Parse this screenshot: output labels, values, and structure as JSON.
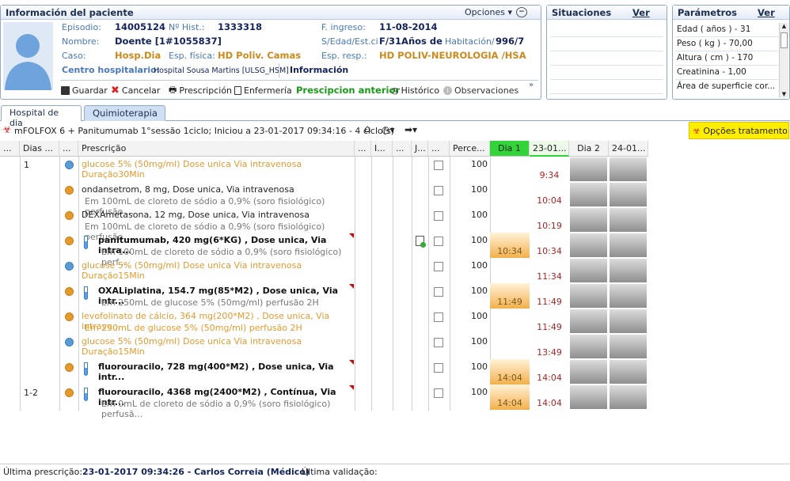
{
  "patient_panel": {
    "title": "Información del paciente",
    "options_label": "Opciones",
    "fields": {
      "episodio_label": "Episodio:",
      "episodio": "14005124",
      "nhist_label": "Nº Hist.:",
      "nhist": "1333318",
      "fingreso_label": "F. ingreso:",
      "fingreso": "11-08-2014",
      "nombre_label": "Nombre:",
      "nombre": "Doente [1#1055837]",
      "sedad_label": "S/Edad/Est.ci",
      "sedad": "F/31Años de",
      "habitacion_label": "Habitación/",
      "habitacion": "996/7",
      "caso_label": "Caso:",
      "caso": "Hosp.Dia",
      "espfisica_label": "Esp. física:",
      "espfisica": "HD Poliv. Camas",
      "espresp_label": "Esp. resp.:",
      "espresp": "HD POLIV-NEUROLOGIA /HSA",
      "centro_label": "Centro hospitalario:",
      "centro": "Hospital Sousa Martins [ULSG_HSM]",
      "info_label": "Información"
    },
    "toolbar": {
      "guardar": "Guardar",
      "cancelar": "Cancelar",
      "prescripcion": "Prescripción",
      "enfermeria": "Enfermería",
      "prescripcion_anterior": "Prescipcion anterior",
      "historico": "Histórico",
      "observaciones": "Observaciones"
    }
  },
  "situaciones": {
    "title": "Situaciones",
    "ver": "Ver"
  },
  "parametros": {
    "title": "Parámetros",
    "ver": "Ver",
    "items": [
      "Edad ( años ) - 31",
      "Peso ( kg ) - 70,00",
      "Altura ( cm ) - 170",
      "Creatinina - 1,00",
      "Área de superficie cor..."
    ]
  },
  "tabs": [
    "Hospital de dia",
    "Quimioterapia"
  ],
  "protocol": {
    "text": "mFOLFOX 6 + Panitumumab 1°sessão 1ciclo; Iniciou a 23-01-2017 09:34:16 - 4 ciclo(s)",
    "options_button": "Opções tratamento"
  },
  "columns": [
    "...",
    "Dias ...",
    "...",
    "Prescrição",
    "...",
    "I...",
    "...",
    "J...",
    "...",
    "Perce...",
    "Dia 1",
    "23-01...",
    "Dia 2",
    "24-01..."
  ],
  "rows": [
    {
      "dias": "1",
      "dot": "blue",
      "l1": "glucose 5% (50mg/ml) Dose unica Via intravenosa Duração30Min",
      "l2": "",
      "pct": "100",
      "d1": "",
      "t": "9:34",
      "style": "orange",
      "tube": false
    },
    {
      "dias": "",
      "dot": "orange",
      "l1": "ondansetrom, 8 mg,   Dose unica, Via intravenosa",
      "l2": "Em 100mL de cloreto de sódio a 0,9% (soro fisiológico) perfusão ...",
      "pct": "100",
      "d1": "",
      "t": "10:04",
      "style": "normal",
      "tube": false
    },
    {
      "dias": "",
      "dot": "orange",
      "l1": "DEXAmetasona, 12 mg,   Dose unica, Via intravenosa",
      "l2": "Em 100mL de cloreto de sódio a 0,9% (soro fisiológico) perfusão ...",
      "pct": "100",
      "d1": "",
      "t": "10:19",
      "style": "normal",
      "tube": false
    },
    {
      "dias": "",
      "dot": "orange",
      "l1": "panitumumab, 420 mg(6*KG) ,   Dose unica, Via intra...",
      "l2": "Em 100mL de cloreto de sódio a 0,9% (soro fisiológico) perf...",
      "pct": "100",
      "d1": "10:34",
      "t": "10:34",
      "style": "bold",
      "tube": true
    },
    {
      "dias": "",
      "dot": "blue",
      "l1": "glucose 5% (50mg/ml) Dose unica Via intravenosa Duração15Min",
      "l2": "",
      "pct": "100",
      "d1": "",
      "t": "11:34",
      "style": "orange",
      "tube": false
    },
    {
      "dias": "",
      "dot": "orange",
      "l1": "OXALiplatina, 154.7 mg(85*M2) ,   Dose unica, Via intr...",
      "l2": "Em 250mL de glucose 5% (50mg/ml) perfusão 2H",
      "pct": "100",
      "d1": "11:49",
      "t": "11:49",
      "style": "bold",
      "tube": true
    },
    {
      "dias": "",
      "dot": "orange",
      "l1": "levofolinato de cálcio, 364 mg(200*M2) ,   Dose unica, Via intrave...",
      "l2": "Em 250mL de glucose 5% (50mg/ml) perfusão 2H",
      "pct": "100",
      "d1": "",
      "t": "11:49",
      "style": "orange",
      "tube": false
    },
    {
      "dias": "",
      "dot": "blue",
      "l1": "glucose 5% (50mg/ml) Dose unica Via intravenosa Duração15Min",
      "l2": "",
      "pct": "100",
      "d1": "",
      "t": "13:49",
      "style": "orange",
      "tube": false
    },
    {
      "dias": "",
      "dot": "orange",
      "l1": "fluorouracilo, 728 mg(400*M2) ,   Dose unica, Via intr...",
      "l2": "",
      "pct": "100",
      "d1": "14:04",
      "t": "14:04",
      "style": "bold",
      "tube": true
    },
    {
      "dias": "1-2",
      "dot": "orange",
      "l1": "fluorouracilo, 4368 mg(2400*M2) ,   Contínua, Via intr...",
      "l2": "Em 0mL de cloreto de sódio a 0,9% (soro fisiológico) perfusã...",
      "pct": "100",
      "d1": "14:04",
      "t": "14:04",
      "style": "bold",
      "tube": true
    }
  ],
  "footer": {
    "ultima_label": "Última prescrição:",
    "ultima_value": "23-01-2017 09:34:26 - Carlos Correia (Médico)",
    "validacao_label": "Última validação:"
  },
  "colors": {
    "orange": "#e59a2e",
    "blue": "#5b9bd5",
    "accent": "#1c2f4f",
    "green_tab": "#2fc83a"
  }
}
